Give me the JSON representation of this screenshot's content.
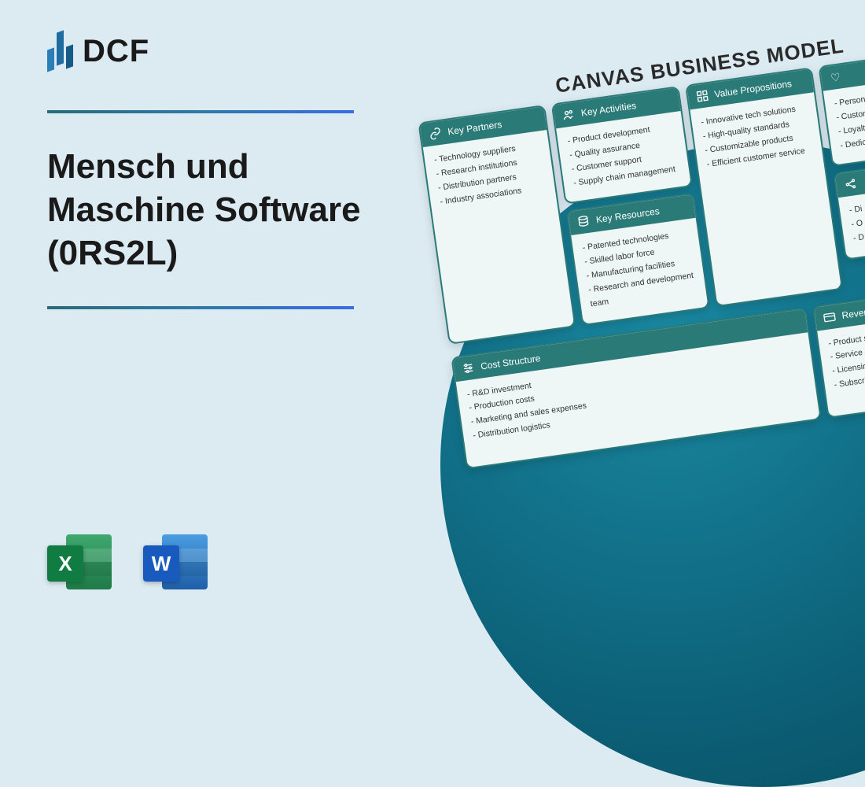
{
  "brand": {
    "name": "DCF"
  },
  "title": "Mensch und Maschine Software (0RS2L)",
  "apps": {
    "excel_letter": "X",
    "word_letter": "W"
  },
  "canvas": {
    "heading": "CANVAS BUSINESS MODEL",
    "partners": {
      "label": "Key Partners",
      "items": [
        "Technology suppliers",
        "Research institutions",
        "Distribution partners",
        "Industry associations"
      ]
    },
    "activities": {
      "label": "Key Activities",
      "items": [
        "Product development",
        "Quality assurance",
        "Customer support",
        "Supply chain management"
      ]
    },
    "resources": {
      "label": "Key Resources",
      "items": [
        "Patented technologies",
        "Skilled labor force",
        "Manufacturing facilities",
        "Research and development team"
      ]
    },
    "value": {
      "label": "Value Propositions",
      "items": [
        "Innovative tech solutions",
        "High-quality standards",
        "Customizable products",
        "Efficient customer service"
      ]
    },
    "customer_rel": {
      "label": "",
      "items": [
        "Personaliz",
        "Customer",
        "Loyalty p",
        "Dedica"
      ]
    },
    "cost": {
      "label": "Cost Structure",
      "items": [
        "R&D investment",
        "Production costs",
        "Marketing and sales expenses",
        "Distribution logistics"
      ]
    },
    "revenue": {
      "label": "Revenue S",
      "items": [
        "Product sales",
        "Service contracts",
        "Licensing agree",
        "Subscription m"
      ]
    },
    "extra": {
      "label": "",
      "items": [
        "Di",
        "O",
        "D"
      ]
    }
  }
}
